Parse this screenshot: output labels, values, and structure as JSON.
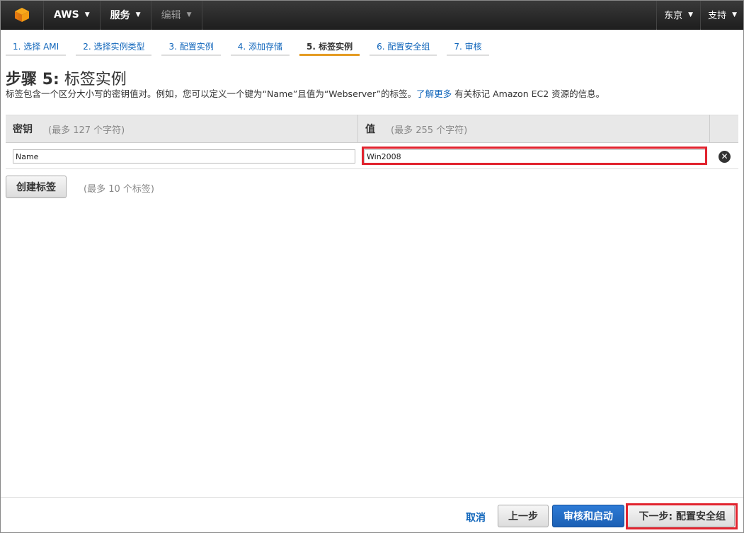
{
  "topbar": {
    "logo_icon": "aws-cube-icon",
    "aws_label": "AWS",
    "services_label": "服务",
    "edit_label": "编辑",
    "region_label": "东京",
    "support_label": "支持"
  },
  "steps": [
    {
      "label": "1. 选择 AMI",
      "active": false
    },
    {
      "label": "2. 选择实例类型",
      "active": false
    },
    {
      "label": "3. 配置实例",
      "active": false
    },
    {
      "label": "4. 添加存储",
      "active": false
    },
    {
      "label": "5. 标签实例",
      "active": true
    },
    {
      "label": "6. 配置安全组",
      "active": false
    },
    {
      "label": "7. 审核",
      "active": false
    }
  ],
  "page": {
    "title_prefix": "步骤 5:",
    "title_main": "标签实例",
    "description_before": "标签包含一个区分大小写的密钥值对。例如，您可以定义一个键为“Name”且值为“Webserver”的标签。",
    "learn_more": "了解更多",
    "description_after": " 有关标记 Amazon EC2 资源的信息。"
  },
  "table": {
    "key_header": "密钥",
    "key_hint": "(最多 127 个字符)",
    "value_header": "值",
    "value_hint": "(最多 255 个字符)",
    "rows": [
      {
        "key": "Name",
        "value": "Win2008"
      }
    ],
    "remove_icon": "close-circle-icon"
  },
  "actions": {
    "add_tag": "创建标签",
    "add_tag_hint": "(最多 10 个标签)"
  },
  "footer": {
    "cancel": "取消",
    "previous": "上一步",
    "review_launch": "审核和启动",
    "next": "下一步: 配置安全组"
  },
  "colors": {
    "accent_tab": "#e49b22",
    "link": "#1166bb",
    "primary_button": "#1a5fb4",
    "highlight": "#e1232e"
  }
}
